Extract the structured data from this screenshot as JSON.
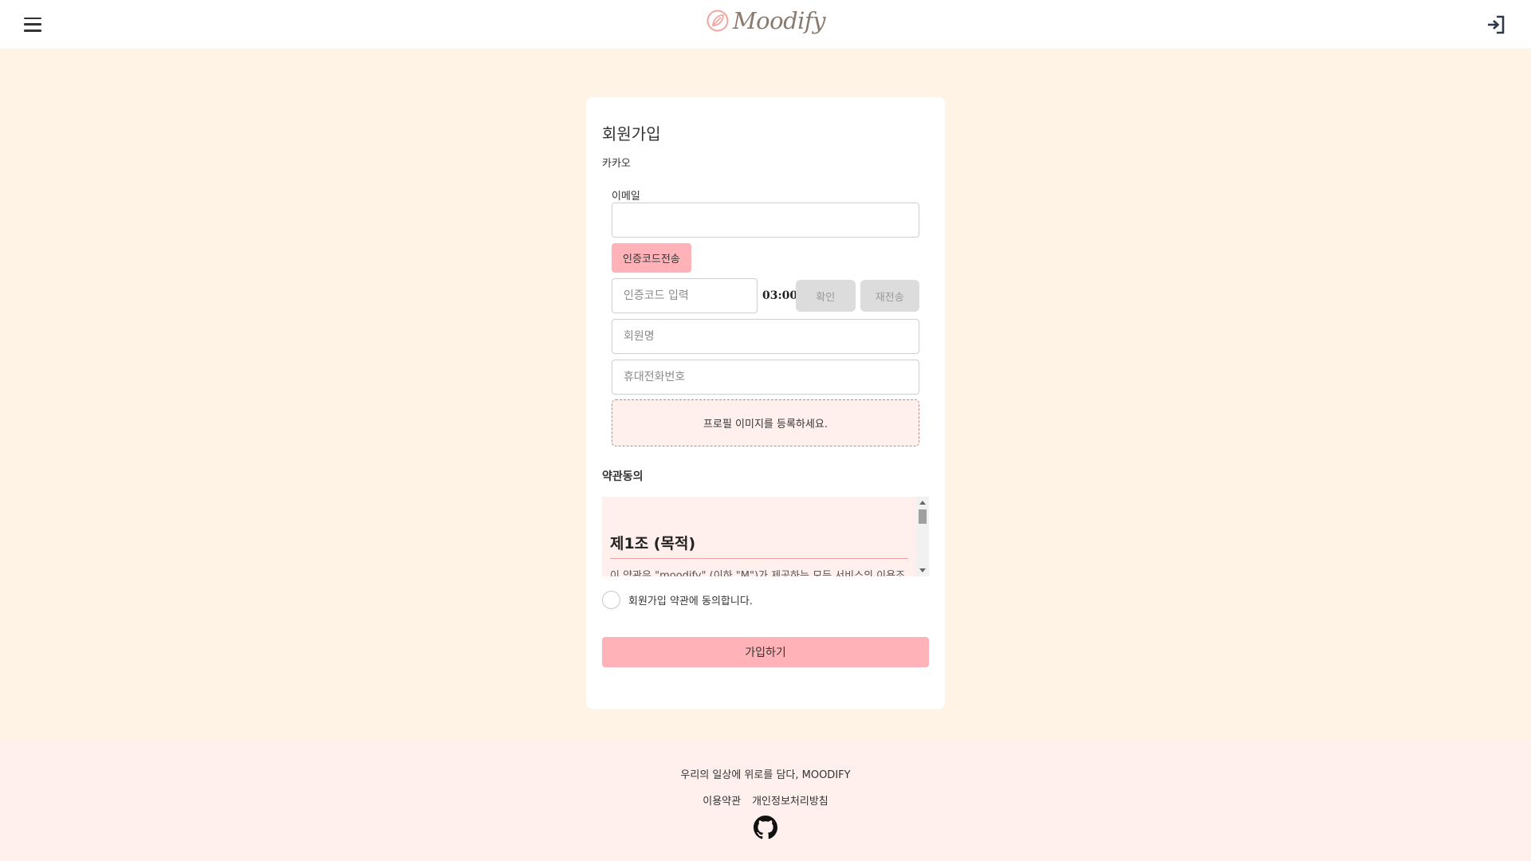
{
  "header": {
    "menu_icon": "hamburger-icon",
    "logo_text": "Moodify",
    "login_icon": "sign-in-icon"
  },
  "signup": {
    "title": "회원가입",
    "subtitle": "카카오",
    "email_label": "이메일",
    "email_value": "",
    "send_code_label": "인증코드전송",
    "code_placeholder": "인증코드 입력",
    "timer": "03:00",
    "confirm_label": "확인",
    "resend_label": "재전송",
    "name_placeholder": "회원명",
    "phone_placeholder": "휴대전화번호",
    "profile_label": "프로필 이미지를 등록하세요.",
    "terms_title": "약관동의",
    "terms_heading": "제1조 (목적)",
    "terms_text": "이 약관은 \"moodify\" (이하 \"M\")가 제공하는 모든 서비스의 이용조",
    "agree_label": "회원가입 약관에 동의합니다.",
    "join_label": "가입하기"
  },
  "footer": {
    "tagline": "우리의 일상에 위로를 담다, MOODIFY",
    "links": [
      "이용약관",
      "개인정보처리방침"
    ],
    "github_icon": "github-icon"
  },
  "colors": {
    "page_bg": "#fff3e6",
    "accent": "#ffb3b8",
    "soft_pink": "#fff0ed"
  }
}
